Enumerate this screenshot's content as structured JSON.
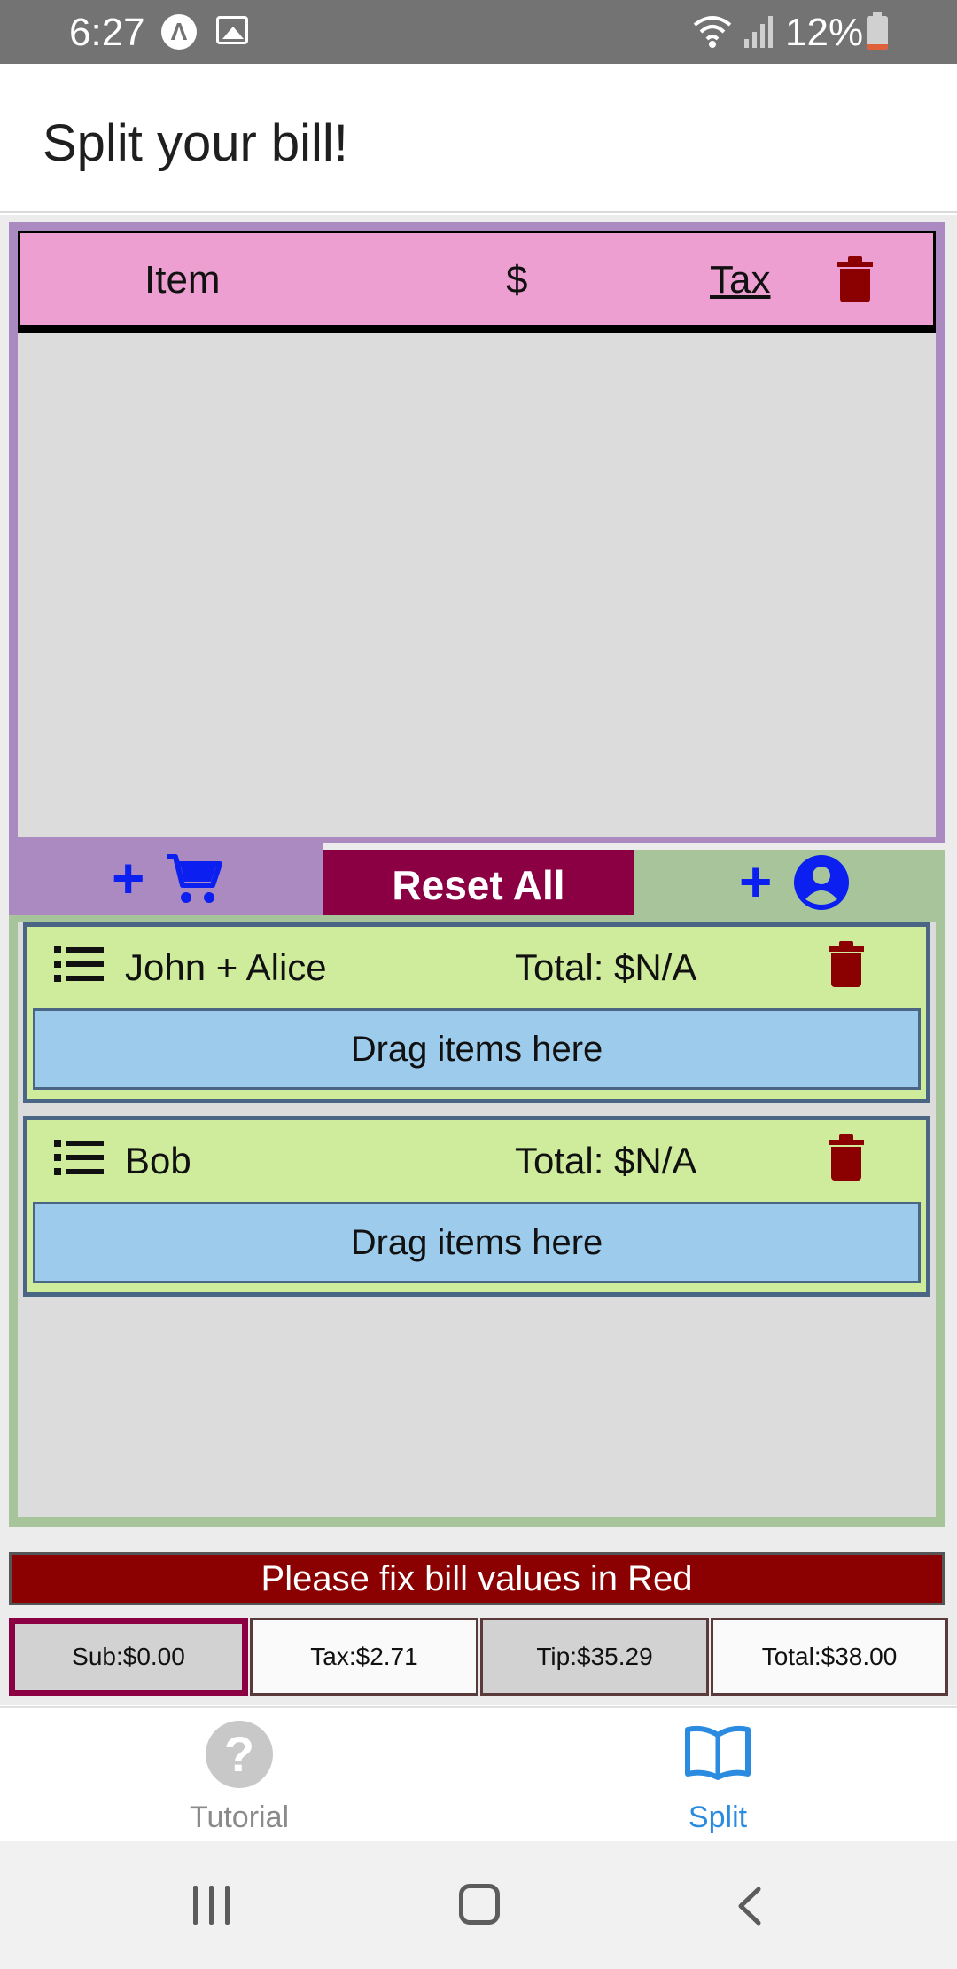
{
  "status_bar": {
    "time": "6:27",
    "battery_text": "12%",
    "icons": [
      "app-icon",
      "image-icon",
      "wifi-icon",
      "signal-icon",
      "battery-icon"
    ]
  },
  "header": {
    "title": "Split your bill!"
  },
  "items_table": {
    "col_item": "Item",
    "col_price": "$",
    "col_tax": "Tax",
    "rows": []
  },
  "actions": {
    "reset_label": "Reset All"
  },
  "people": [
    {
      "name": "John + Alice",
      "total": "Total: $N/A",
      "drop_hint": "Drag items here"
    },
    {
      "name": "Bob",
      "total": "Total: $N/A",
      "drop_hint": "Drag items here"
    }
  ],
  "warning": "Please fix bill values in Red",
  "totals": {
    "sub": "Sub:$0.00",
    "tax": "Tax:$2.71",
    "tip": "Tip:$35.29",
    "total": "Total:$38.00"
  },
  "tabs": [
    {
      "label": "Tutorial",
      "icon": "help-circle-icon",
      "active": false
    },
    {
      "label": "Split",
      "icon": "book-open-icon",
      "active": true
    }
  ],
  "colors": {
    "items_panel": "#aa8ac0",
    "items_header": "#ec9fd0",
    "people_panel": "#a7c49a",
    "person_card": "#cfec9c",
    "drop_zone": "#9ccbec",
    "reset_button": "#8b0043",
    "warning": "#8b0000",
    "accent_blue": "#0a1ff0",
    "tab_active": "#2a8be0"
  }
}
